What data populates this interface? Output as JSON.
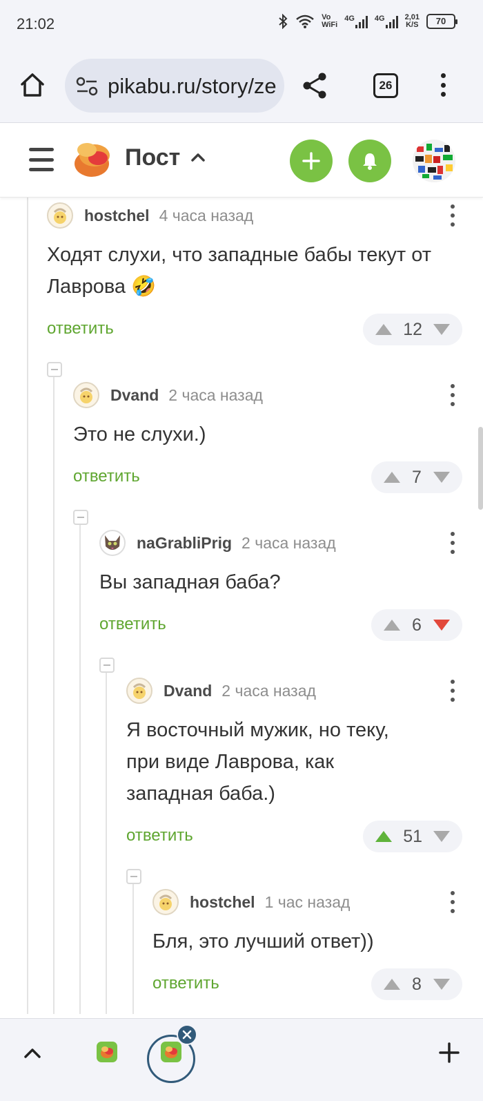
{
  "status_bar": {
    "time": "21:02",
    "net_top": "Vo",
    "net_bottom": "WiFi",
    "sim1": "4G",
    "sim2": "4G",
    "speed_value": "2,01",
    "speed_unit": "K/S",
    "battery": "70",
    "icons": [
      "bluetooth-icon",
      "wifi-icon",
      "signal-icon",
      "battery-icon"
    ]
  },
  "browser": {
    "url": "pikabu.ru/story/ze",
    "tab_count": "26"
  },
  "header": {
    "title": "Пост",
    "accent_color": "#7ac244"
  },
  "comments": [
    {
      "user": "hostchel",
      "time": "4 часа назад",
      "text": "Ходят слухи, что западные бабы текут от Лаврова 🤣",
      "reply": "ответить",
      "votes": "12",
      "vote_state": "none"
    },
    {
      "user": "Dvand",
      "time": "2 часа назад",
      "text": "Это не слухи.)",
      "reply": "ответить",
      "votes": "7",
      "vote_state": "none"
    },
    {
      "user": "naGrabliPrig",
      "time": "2 часа назад",
      "text": "Вы западная баба?",
      "reply": "ответить",
      "votes": "6",
      "vote_state": "down"
    },
    {
      "user": "Dvand",
      "time": "2 часа назад",
      "text": "Я восточный мужик, но теку, при виде Лаврова, как западная баба.)",
      "reply": "ответить",
      "votes": "51",
      "vote_state": "up"
    },
    {
      "user": "hostchel",
      "time": "1 час назад",
      "text": "Бля, это лучший ответ))",
      "reply": "ответить",
      "votes": "8",
      "vote_state": "none"
    }
  ],
  "colors": {
    "upvote_active": "#5fb33b",
    "downvote_active": "#e2483b",
    "vote_inactive": "#a9a9a9",
    "reply_link": "#5fa630"
  }
}
